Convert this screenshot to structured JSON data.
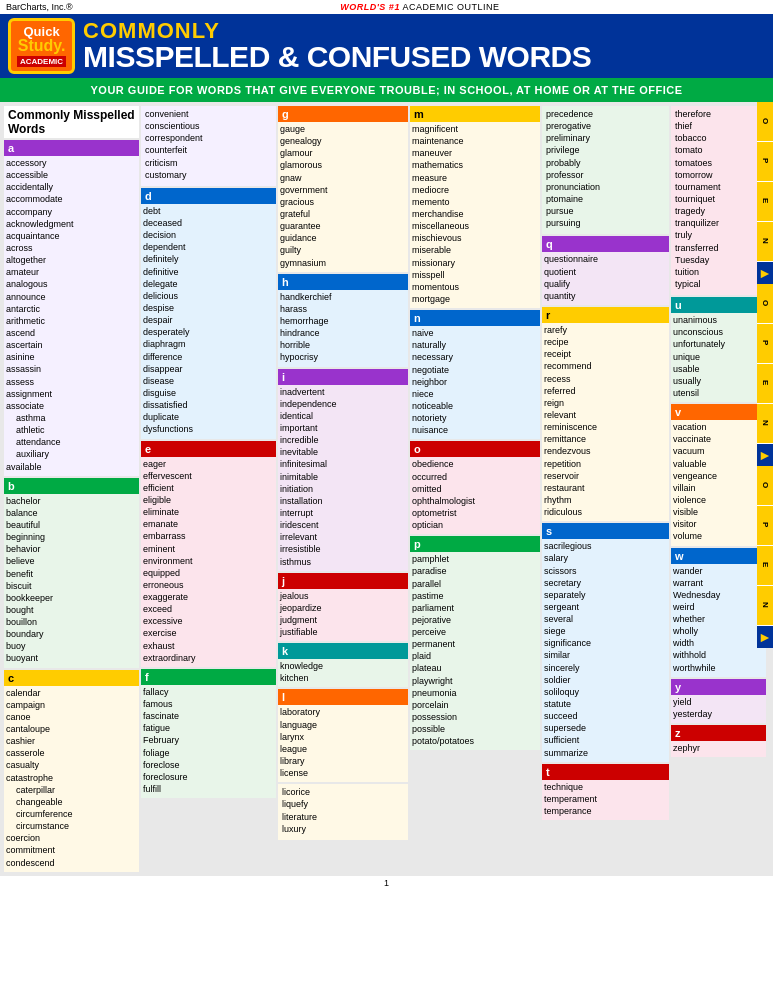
{
  "topBar": {
    "left": "BarCharts, Inc.®",
    "centerPre": "WORLD'S #1",
    "centerPost": " ACADEMIC OUTLINE",
    "right": ""
  },
  "header": {
    "logo": {
      "quick": "Quick",
      "study": "Study.",
      "academic": "ACADEMIC"
    },
    "commonly": "COMMONLY",
    "mainTitle": "MISSPELLED & CONFUSED WORDS"
  },
  "subtitleBar": "YOUR GUIDE FOR WORDS THAT GIVE EVERYONE TROUBLE; IN SCHOOL, AT HOME OR AT THE OFFICE",
  "sectionMainTitle": "Commonly Misspelled Words",
  "columns": {
    "a": {
      "label": "a",
      "words": [
        "accessory",
        "accessible",
        "accidentally",
        "accommodate",
        "accompany",
        "acknowledgment",
        "acquaintance",
        "across",
        "altogether",
        "amateur",
        "analogous",
        "announce",
        "antarctic",
        "arithmetic",
        "ascend",
        "ascertain",
        "asinine",
        "assassin",
        "assess",
        "assignment",
        "associate",
        "asthma",
        "athletic",
        "attendance",
        "auxiliary",
        "available"
      ]
    },
    "aRight": {
      "label": "",
      "words": [
        "convenient",
        "conscientious",
        "correspondent",
        "counterfeit",
        "criticism",
        "customary"
      ]
    },
    "b": {
      "label": "b",
      "words": [
        "bachelor",
        "balance",
        "beautiful",
        "beginning",
        "behavior",
        "believe",
        "benefit",
        "biscuit",
        "bookkeeper",
        "bought",
        "bouillon",
        "boundary",
        "buoy",
        "buoyant"
      ]
    },
    "c": {
      "label": "c",
      "words": [
        "calendar",
        "campaign",
        "canoe",
        "cantaloupe",
        "cashier",
        "casserole",
        "casualty",
        "catastrophe",
        "caterpillar",
        "changeable",
        "circumference",
        "circumstance",
        "coercion",
        "commitment",
        "condescend"
      ]
    },
    "d": {
      "label": "d",
      "words": [
        "debt",
        "deceased",
        "decision",
        "dependent",
        "definitely",
        "definitive",
        "delegate",
        "delicious",
        "despise",
        "despair",
        "desperately",
        "diaphragm",
        "difference",
        "disappear",
        "disease",
        "disguise",
        "dissatisfied",
        "duplicate",
        "dysfunctions"
      ]
    },
    "e": {
      "label": "e",
      "words": [
        "eager",
        "effervescent",
        "efficient",
        "eligible",
        "eliminate",
        "emanate",
        "embarrass",
        "eminent",
        "environment",
        "equipped",
        "erroneous",
        "exaggerate",
        "exceed",
        "excessive",
        "exercise",
        "exhaust",
        "extraordinary"
      ]
    },
    "f": {
      "label": "f",
      "words": [
        "fallacy",
        "famous",
        "fascinate",
        "fatigue",
        "February",
        "foliage",
        "foreclose",
        "foreclosure",
        "fulfill"
      ]
    },
    "g": {
      "label": "g",
      "words": [
        "gauge",
        "genealogy",
        "glamour",
        "glamorous",
        "gnaw",
        "government",
        "gracious",
        "grateful",
        "guarantee",
        "guidance",
        "guilty",
        "gymnasium"
      ]
    },
    "h": {
      "label": "h",
      "words": [
        "handkerchief",
        "harass",
        "hemorrhage",
        "hindrance",
        "horrible",
        "hypocrisy"
      ]
    },
    "i": {
      "label": "i",
      "words": [
        "inadvertent",
        "independence",
        "identical",
        "important",
        "incredible",
        "inevitable",
        "infinitesimal",
        "inimitable",
        "initiation",
        "installation",
        "interrupt",
        "iridescent",
        "irrelevant",
        "irresistible",
        "isthmus"
      ]
    },
    "j": {
      "label": "j",
      "words": [
        "jealous",
        "jeopardize",
        "judgment",
        "justifiable"
      ]
    },
    "k": {
      "label": "k",
      "words": [
        "knowledge",
        "kitchen"
      ]
    },
    "l": {
      "label": "l",
      "words": [
        "laboratory",
        "language",
        "larynx",
        "league",
        "library",
        "license"
      ]
    },
    "licorice": {
      "label": "",
      "words": [
        "licorice",
        "liquefy",
        "literature",
        "luxury"
      ]
    },
    "m": {
      "label": "m",
      "words": [
        "magnificent",
        "maintenance",
        "maneuver",
        "mathematics",
        "measure",
        "mediocre",
        "memento",
        "merchandise",
        "miscellaneous",
        "mischievous",
        "miserable",
        "missionary",
        "misspell",
        "momentous",
        "mortgage"
      ]
    },
    "n": {
      "label": "n",
      "words": [
        "naive",
        "naturally",
        "necessary",
        "negotiate",
        "neighbor",
        "niece",
        "noticeable",
        "notoriety",
        "nuisance"
      ]
    },
    "o": {
      "label": "o",
      "words": [
        "obedience",
        "occurred",
        "omitted",
        "ophthalmologist",
        "optometrist",
        "optician"
      ]
    },
    "p": {
      "label": "p",
      "words": [
        "pamphlet",
        "paradise",
        "parallel",
        "pastime",
        "parliament",
        "pejorative",
        "perceive",
        "permanent",
        "plaid",
        "plateau",
        "playwright",
        "pneumonia",
        "porcelain",
        "possession",
        "possible",
        "potato/potatoes"
      ]
    },
    "precedence": {
      "label": "",
      "words": [
        "precedence",
        "prerogative",
        "preliminary",
        "privilege",
        "probably",
        "professor",
        "pronunciation",
        "ptomaine",
        "pursue",
        "pursuing"
      ]
    },
    "q": {
      "label": "q",
      "words": [
        "questionnaire",
        "quotient",
        "qualify",
        "quantity"
      ]
    },
    "r": {
      "label": "r",
      "words": [
        "rarefy",
        "recipe",
        "receipt",
        "recommend",
        "recess",
        "referred",
        "reign",
        "relevant",
        "reminiscence",
        "remittance",
        "rendezvous",
        "repetition",
        "reservoir",
        "restaurant",
        "rhythm",
        "ridiculous"
      ]
    },
    "s": {
      "label": "s",
      "words": [
        "sacrilegious",
        "salary",
        "scissors",
        "secretary",
        "separately",
        "sergeant",
        "several",
        "siege",
        "significance",
        "similar",
        "sincerely",
        "soldier",
        "soliloquy",
        "statute",
        "succeed",
        "supersede",
        "sufficient",
        "summarize"
      ]
    },
    "t": {
      "label": "t",
      "words": [
        "technique",
        "temperament",
        "temperance"
      ]
    },
    "therefore": {
      "label": "",
      "words": [
        "therefore",
        "thief",
        "tobacco",
        "tomato",
        "tomatoes",
        "tomorrow",
        "tournament",
        "tourniquet",
        "tragedy",
        "tranquilizer",
        "truly",
        "transferred",
        "Tuesday",
        "tuition",
        "typical"
      ]
    },
    "u": {
      "label": "u",
      "words": [
        "unanimous",
        "unconscious",
        "unfortunately",
        "unique",
        "usable",
        "usually",
        "utensil"
      ]
    },
    "v": {
      "label": "v",
      "words": [
        "vacation",
        "vaccinate",
        "vacuum",
        "valuable",
        "vengeance",
        "villain",
        "violence",
        "visible",
        "visitor",
        "volume"
      ]
    },
    "w": {
      "label": "w",
      "words": [
        "wander",
        "warrant",
        "Wednesday",
        "weird",
        "whether",
        "wholly",
        "width",
        "withhold",
        "worthwhile"
      ]
    },
    "y": {
      "label": "y",
      "words": [
        "yield",
        "yesterday"
      ]
    },
    "z": {
      "label": "z",
      "words": [
        "zephyr"
      ]
    }
  },
  "rightTabs": [
    "O",
    "P",
    "E",
    "N"
  ],
  "pageNumber": "1"
}
